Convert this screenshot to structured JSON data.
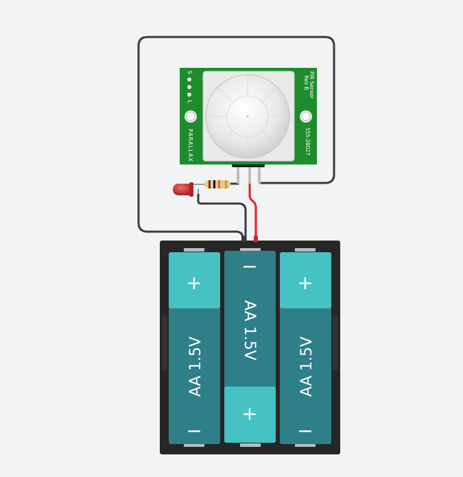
{
  "pir_sensor": {
    "title_line1": "PIR Sensor",
    "title_line2": "Rev B",
    "part_number": "555-28027",
    "brand": "PARALLAX",
    "pin_labels": [
      "S",
      "+",
      "-",
      "L"
    ]
  },
  "battery_pack": {
    "cells": [
      {
        "label": "AA 1.5V",
        "plus": "+",
        "minus": "−"
      },
      {
        "label": "AA 1.5V",
        "plus": "+",
        "minus": "−"
      },
      {
        "label": "AA 1.5V",
        "plus": "+",
        "minus": "−"
      }
    ]
  },
  "colors": {
    "background": "#f1f3f5",
    "pcb": "#1e8c2c",
    "wire_dark": "#3a3a3a",
    "wire_red": "#e02020",
    "battery_case": "#262626",
    "cell_body": "#2e7f87",
    "cell_cap": "#46c1c4",
    "led": "#c62a2a"
  }
}
